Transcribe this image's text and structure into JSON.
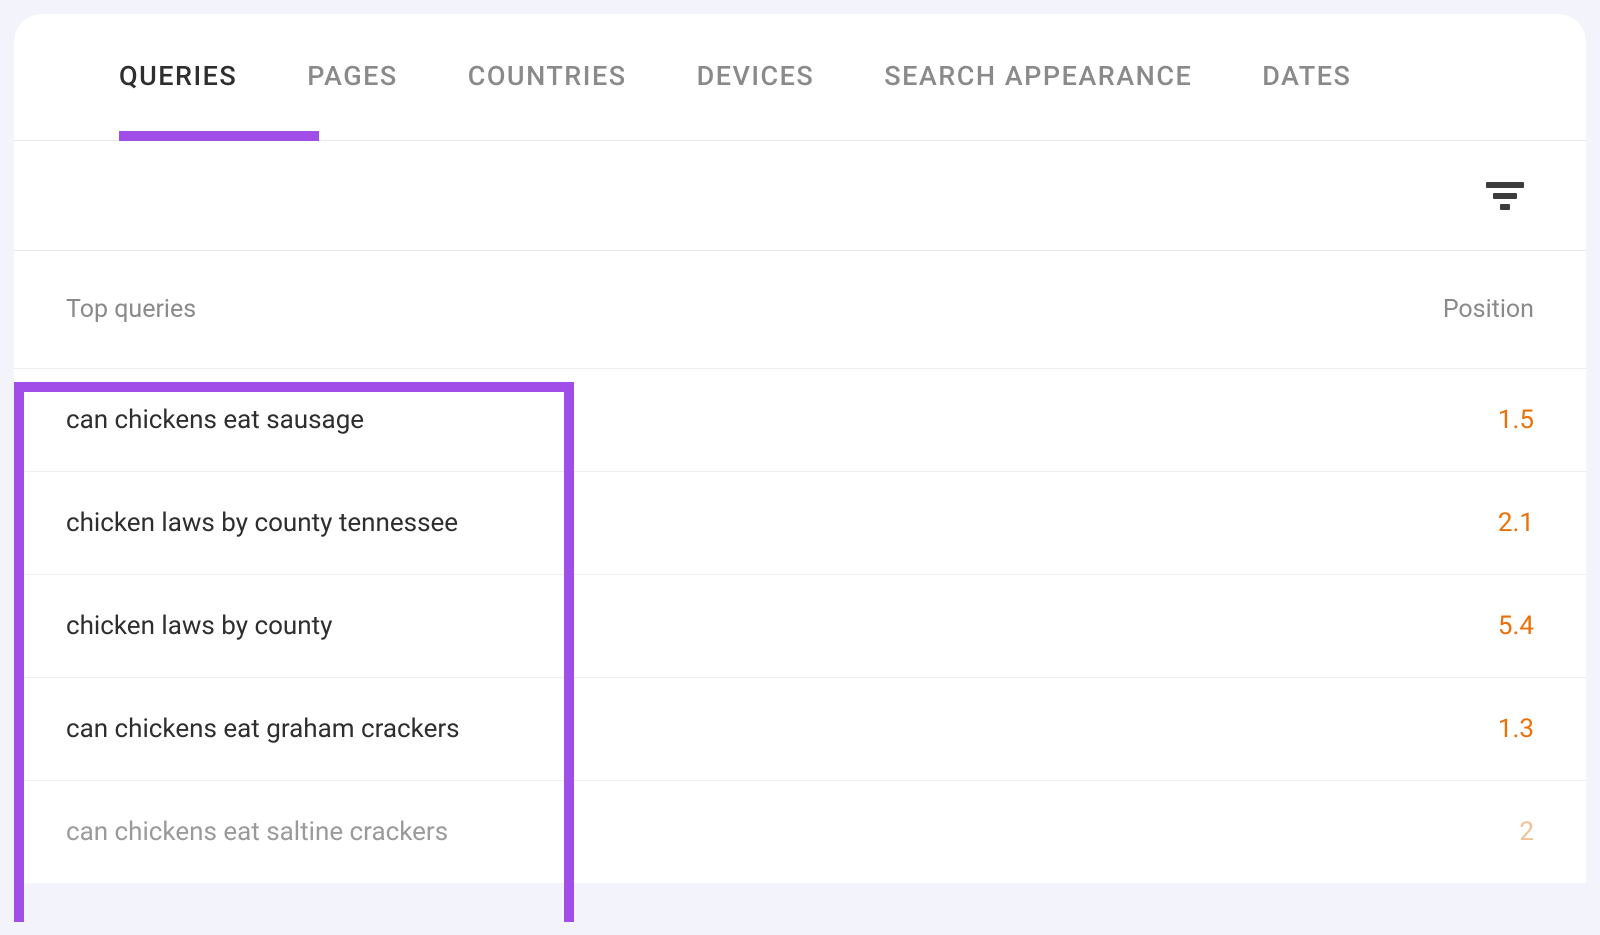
{
  "tabs": {
    "items": [
      {
        "label": "QUERIES",
        "active": true
      },
      {
        "label": "PAGES",
        "active": false
      },
      {
        "label": "COUNTRIES",
        "active": false
      },
      {
        "label": "DEVICES",
        "active": false
      },
      {
        "label": "SEARCH APPEARANCE",
        "active": false
      },
      {
        "label": "DATES",
        "active": false
      }
    ]
  },
  "table": {
    "header_left": "Top queries",
    "header_right": "Position",
    "rows": [
      {
        "query": "can chickens eat sausage",
        "position": "1.5",
        "faded": false
      },
      {
        "query": "chicken laws by county tennessee",
        "position": "2.1",
        "faded": false
      },
      {
        "query": "chicken laws by county",
        "position": "5.4",
        "faded": false
      },
      {
        "query": "can chickens eat graham crackers",
        "position": "1.3",
        "faded": false
      },
      {
        "query": "can chickens eat saltine crackers",
        "position": "2",
        "faded": true
      }
    ]
  },
  "colors": {
    "accent": "#a14ee8",
    "position_value": "#e8710a"
  }
}
